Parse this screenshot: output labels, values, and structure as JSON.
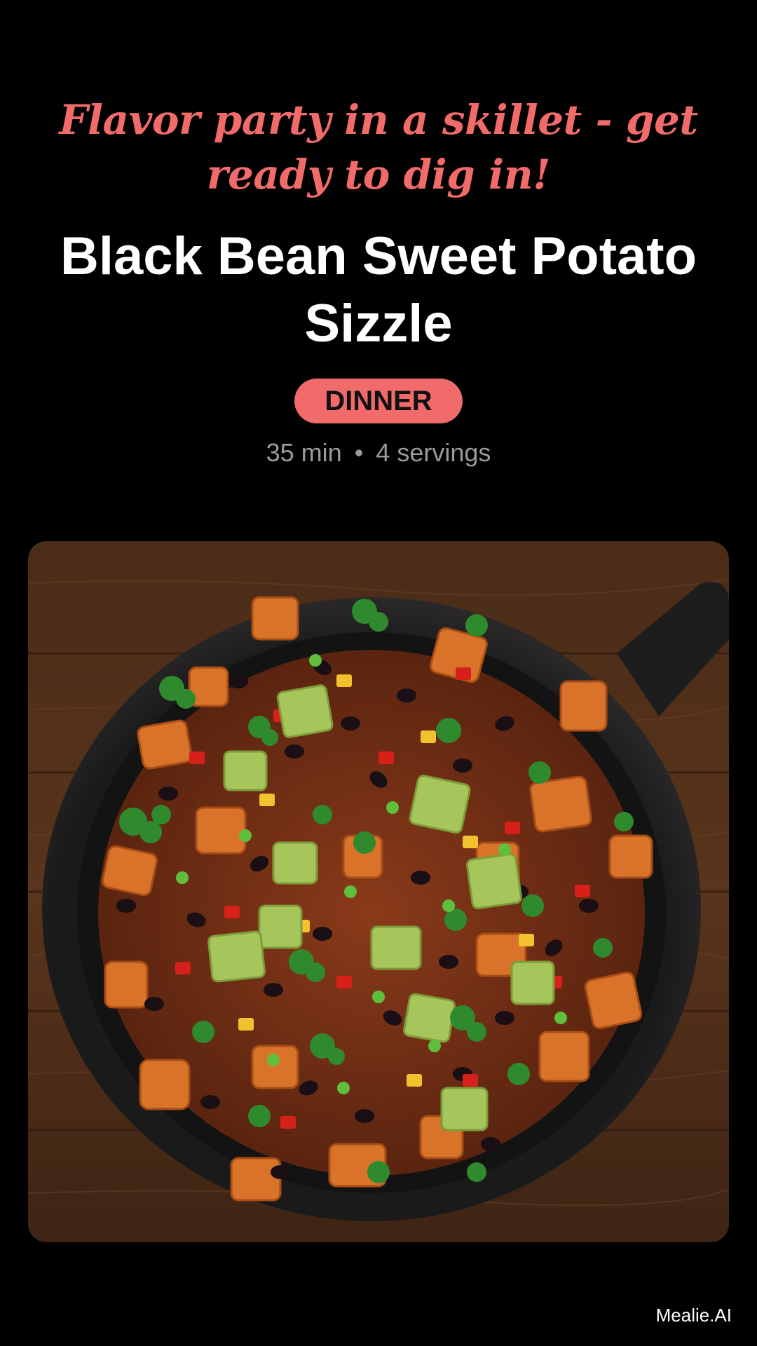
{
  "recipe": {
    "tagline": "Flavor party in a skillet - get ready to dig in!",
    "title": "Black Bean Sweet Potato Sizzle",
    "category": "DINNER",
    "time": "35 min",
    "separator": "•",
    "servings": "4 servings",
    "image_alt": "Skillet of roasted sweet potato, black beans, avocado, peppers and cilantro"
  },
  "footer": {
    "brand": "Mealie.AI"
  },
  "colors": {
    "accent": "#F26B6B",
    "background": "#000000",
    "muted_text": "#9A9A9A"
  }
}
